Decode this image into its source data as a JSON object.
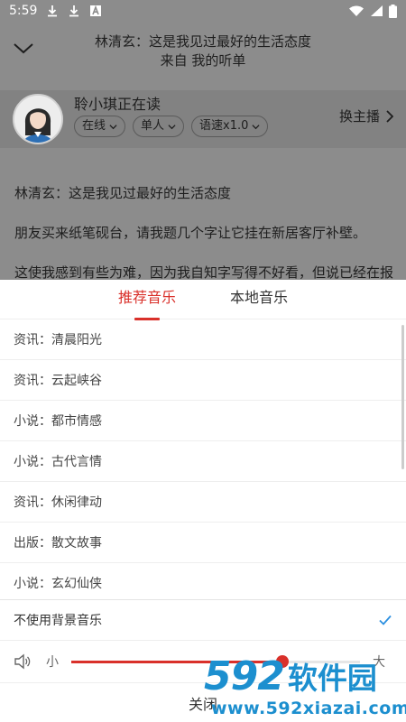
{
  "status_bar": {
    "time": "5:59",
    "icons": [
      "download-icon",
      "download-icon",
      "a-notification-icon",
      "wifi-icon",
      "signal-icon",
      "battery-icon"
    ]
  },
  "header": {
    "collapse_icon": "chevron-down-icon",
    "title_line1": "林清玄：这是我见过最好的生活态度",
    "title_line2": "来自 我的听单"
  },
  "anchor": {
    "name_status": "聆小琪正在读",
    "tags": [
      "在线",
      "单人",
      "语速x1.0"
    ],
    "switch_label": "换主播"
  },
  "article": {
    "paragraphs": [
      "林清玄：这是我见过最好的生活态度",
      "朋友买来纸笔砚台，请我题几个字让它挂在新居客厅补壁。",
      "这使我感到有些为难，因为我自知字写得不好看，但说已经在报"
    ]
  },
  "sheet": {
    "tabs": [
      {
        "label": "推荐音乐",
        "active": true
      },
      {
        "label": "本地音乐",
        "active": false
      }
    ],
    "music_items": [
      "资讯：清晨阳光",
      "资讯：云起峡谷",
      "小说：都市情感",
      "小说：古代言情",
      "资讯：休闲律动",
      "出版：散文故事",
      "小说：玄幻仙侠"
    ],
    "no_bg_music_label": "不使用背景音乐",
    "no_bg_music_selected": true,
    "volume": {
      "min_label": "小",
      "max_label": "大",
      "level": 0.73
    },
    "close_label": "关闭"
  },
  "watermark": {
    "number": "592",
    "name": "软件园",
    "url": "www.592xiazai.com"
  },
  "colors": {
    "accent": "#d9302a",
    "check": "#2b8fe0",
    "watermark": "#1c8fcf",
    "overlay": "#8c8c8c"
  }
}
